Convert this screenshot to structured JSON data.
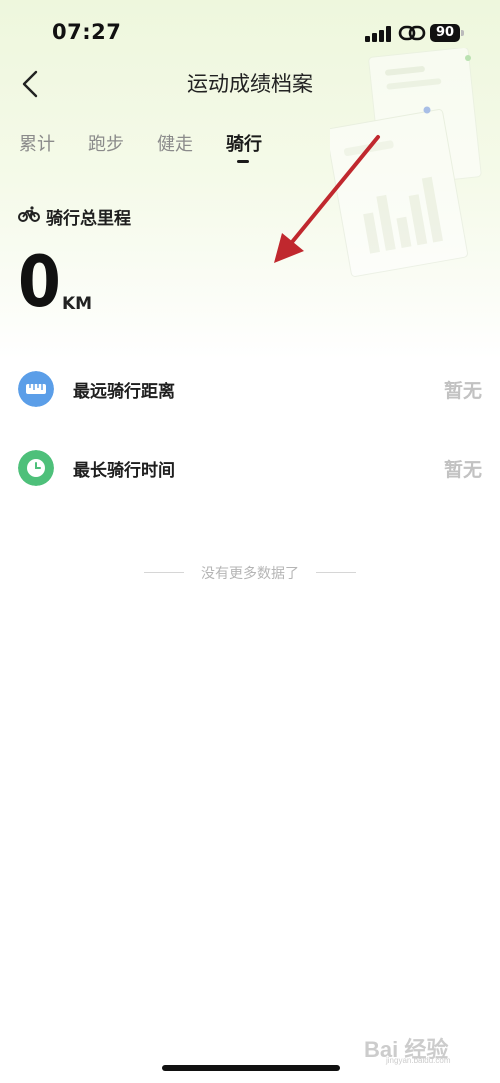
{
  "status_bar": {
    "time": "07:27",
    "battery": "90"
  },
  "header": {
    "title": "运动成绩档案"
  },
  "tabs": [
    {
      "label": "累计",
      "active": false
    },
    {
      "label": "跑步",
      "active": false
    },
    {
      "label": "健走",
      "active": false
    },
    {
      "label": "骑行",
      "active": true
    }
  ],
  "total": {
    "label": "骑行总里程",
    "value": "0",
    "unit": "KM"
  },
  "records": [
    {
      "label": "最远骑行距离",
      "value": "暂无",
      "icon": "ruler-icon",
      "icon_color": "#5b9ee8"
    },
    {
      "label": "最长骑行时间",
      "value": "暂无",
      "icon": "clock-icon",
      "icon_color": "#4ec07a"
    }
  ],
  "footer": {
    "no_more": "没有更多数据了"
  },
  "watermark": {
    "text": "Bai 经验",
    "sub": "jingyan.baidu.com"
  },
  "colors": {
    "accent_blue": "#5b9ee8",
    "accent_green": "#4ec07a",
    "annotation_arrow": "#c0282e",
    "muted_text": "#c2c2c2"
  }
}
